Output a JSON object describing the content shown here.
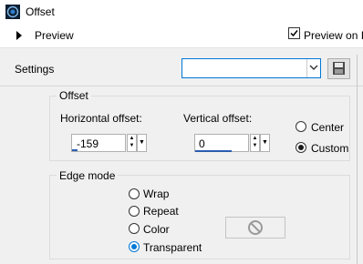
{
  "window": {
    "title": "Offset"
  },
  "preview": {
    "label": "Preview",
    "preview_on_label": "Preview on In",
    "preview_on_checked": true
  },
  "settings": {
    "label": "Settings",
    "value": ""
  },
  "offset": {
    "group_label": "Offset",
    "horizontal_label": "Horizontal offset:",
    "horizontal_value": "-159",
    "vertical_label": "Vertical offset:",
    "vertical_value": "0",
    "center_label": "Center",
    "custom_label": "Custom",
    "selected": "Custom"
  },
  "edge_mode": {
    "group_label": "Edge mode",
    "options": [
      "Wrap",
      "Repeat",
      "Color",
      "Transparent"
    ],
    "selected": "Transparent"
  },
  "icons": {
    "app": "offset-app-icon",
    "save": "floppy-disk-icon",
    "color_disabled": "no-symbol-icon"
  },
  "colors": {
    "accent": "#0078d7"
  }
}
